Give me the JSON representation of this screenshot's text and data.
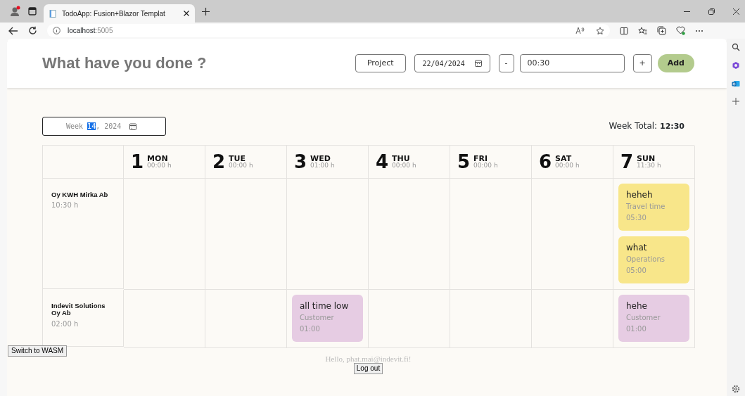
{
  "browser": {
    "tabs": [
      {
        "title": "TodoApp: Fusion+Blazor Templat",
        "selected": true
      }
    ],
    "address": {
      "host": "localhost",
      "port": ":5005"
    }
  },
  "header": {
    "title": "What have you done ?",
    "project_button": "Project",
    "date_value": "22/04/2024",
    "minus_button": "-",
    "duration_value": "00:30",
    "plus_button": "+",
    "add_button": "Add"
  },
  "week": {
    "picker": {
      "before": "Week ",
      "selected": "14",
      "after": ", 2024"
    },
    "total_label": "Week Total:",
    "total_value": "12:30"
  },
  "days": [
    {
      "number": "1",
      "name": "MON",
      "hours": "00:00 h"
    },
    {
      "number": "2",
      "name": "TUE",
      "hours": "00:00 h"
    },
    {
      "number": "3",
      "name": "WED",
      "hours": "01:00 h"
    },
    {
      "number": "4",
      "name": "THU",
      "hours": "00:00 h"
    },
    {
      "number": "5",
      "name": "FRI",
      "hours": "00:00 h"
    },
    {
      "number": "6",
      "name": "SAT",
      "hours": "00:00 h"
    },
    {
      "number": "7",
      "name": "SUN",
      "hours": "11:30 h"
    }
  ],
  "projects": [
    {
      "name": "Oy KWH Mirka Ab",
      "hours": "10:30 h",
      "cells": [
        {},
        {},
        {},
        {},
        {},
        {},
        {
          "entries": [
            {
              "title": "heheh",
              "category": "Travel time",
              "duration": "05:30",
              "color": "#f8e68a"
            },
            {
              "title": "what",
              "category": "Operations",
              "duration": "05:00",
              "color": "#f8e68a"
            }
          ]
        }
      ]
    },
    {
      "name": "Indevit Solutions Oy Ab",
      "hours": "02:00 h",
      "cells": [
        {},
        {},
        {
          "entries": [
            {
              "title": "all time low",
              "category": "Customer",
              "duration": "01:00",
              "color": "#e6cce3"
            }
          ]
        },
        {},
        {},
        {},
        {
          "entries": [
            {
              "title": "hehe",
              "category": "Customer",
              "duration": "01:00",
              "color": "#e6cce3"
            }
          ]
        }
      ]
    }
  ],
  "footer": {
    "switch_button": "Switch to WASM",
    "greeting": "Hello, phat.mai@indevit.fi!",
    "logout_button": "Log out"
  }
}
